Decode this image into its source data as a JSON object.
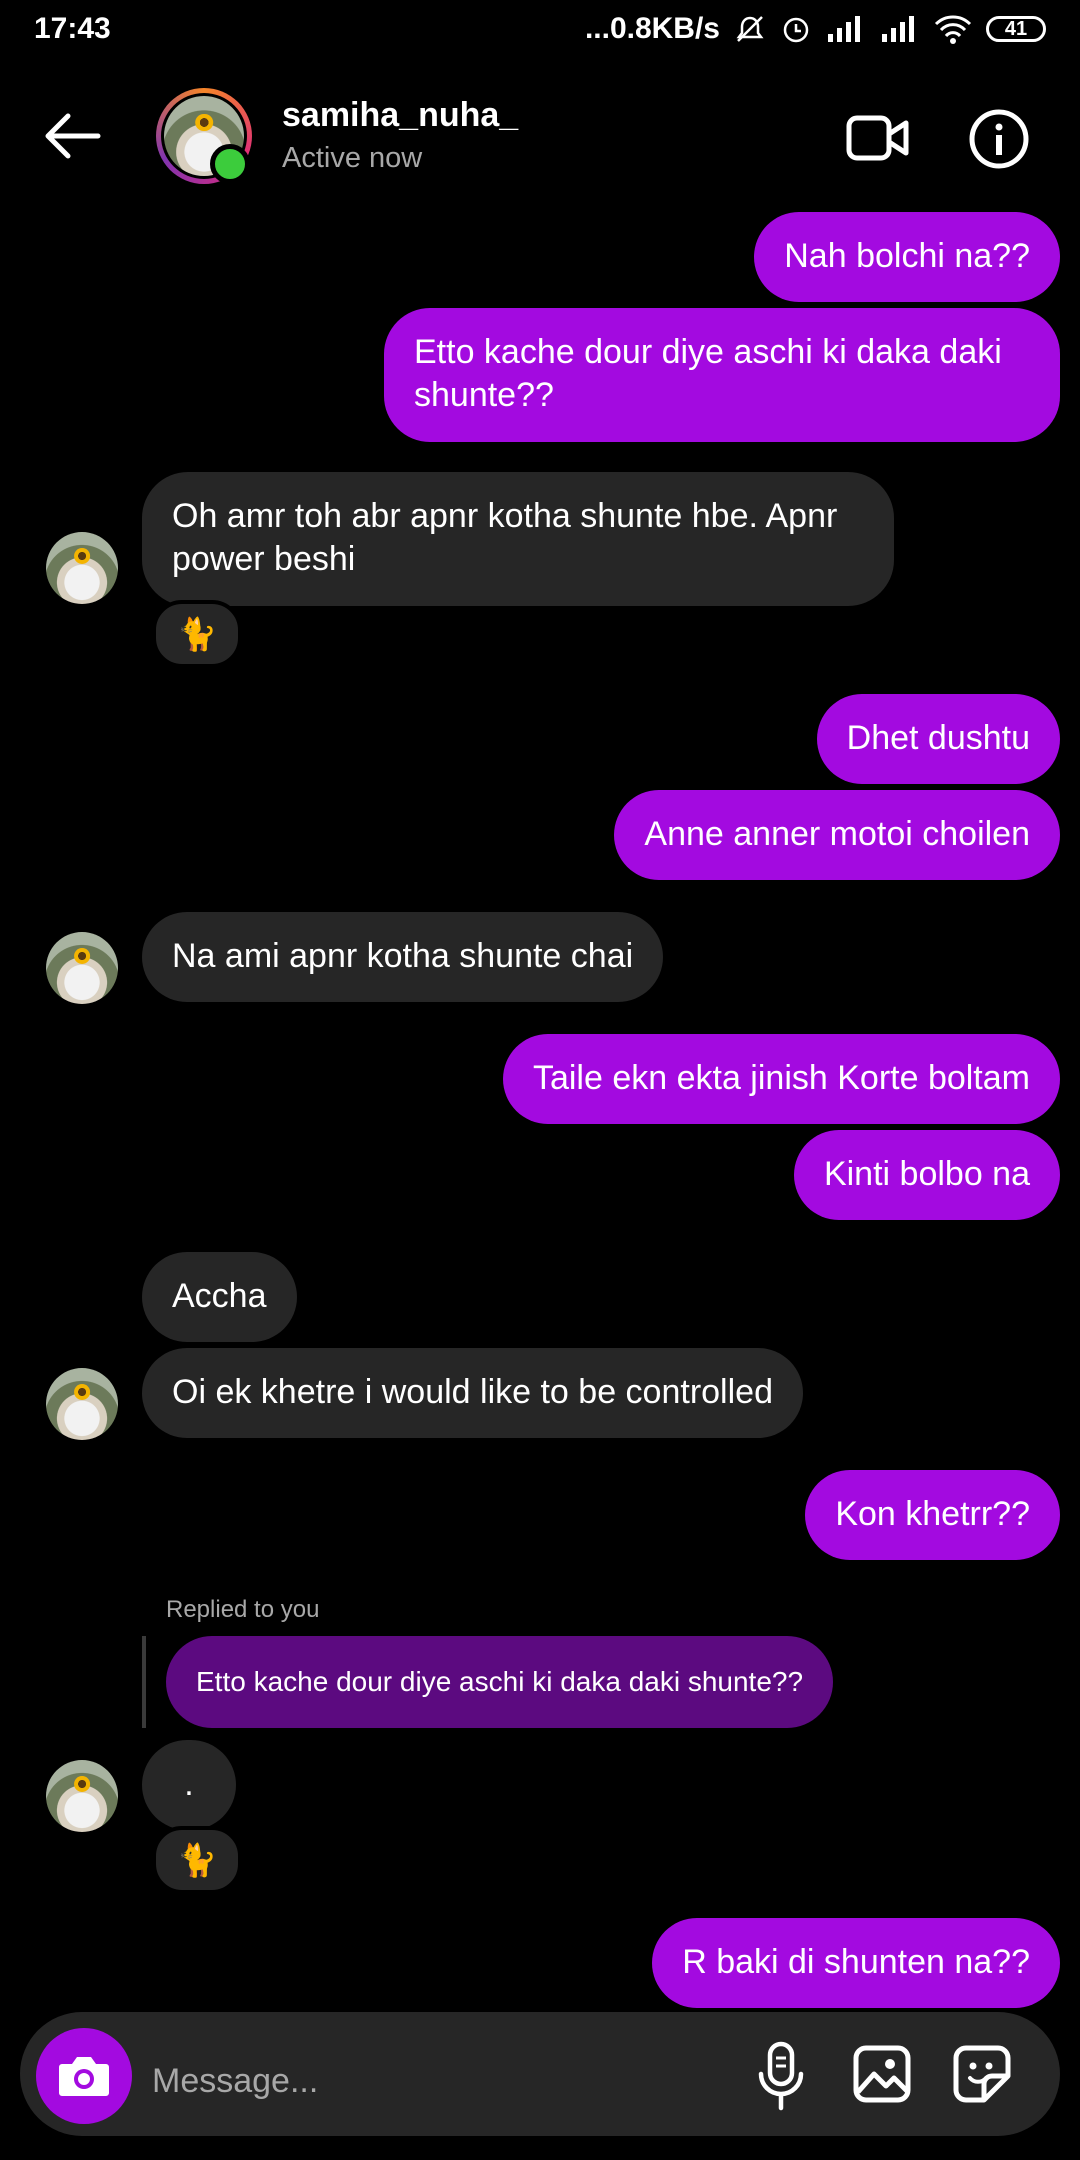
{
  "status_bar": {
    "time": "17:43",
    "net_speed": "...0.8KB/s",
    "battery": "41"
  },
  "header": {
    "username": "samiha_nuha_",
    "status": "Active now"
  },
  "messages": [
    {
      "from": "me",
      "text": "Nah bolchi na??"
    },
    {
      "from": "me",
      "text": "Etto kache dour diye aschi ki daka daki shunte??"
    },
    {
      "from": "them",
      "text": "Oh amr toh abr apnr kotha shunte hbe. Apnr power beshi",
      "reaction": "🐈"
    },
    {
      "from": "me",
      "text": "Dhet dushtu"
    },
    {
      "from": "me",
      "text": "Anne anner motoi choilen"
    },
    {
      "from": "them",
      "text": "Na ami apnr kotha shunte chai"
    },
    {
      "from": "me",
      "text": "Taile ekn ekta jinish Korte boltam"
    },
    {
      "from": "me",
      "text": "Kinti bolbo na"
    },
    {
      "from": "them",
      "text": "Accha"
    },
    {
      "from": "them",
      "text": "Oi ek khetre i would like to be controlled"
    },
    {
      "from": "me",
      "text": "Kon khetrr??"
    },
    {
      "from": "them",
      "reply_label": "Replied to you",
      "quoted": "Etto kache dour diye aschi ki daka daki shunte??",
      "text": ".",
      "reaction": "🐈"
    },
    {
      "from": "me",
      "text": "R baki di shunten na??"
    }
  ],
  "composer": {
    "placeholder": "Message..."
  },
  "colors": {
    "sent_bubble": "#a30ae0",
    "received_bubble": "#262626",
    "quoted_bubble": "#5c0a80",
    "online": "#3ccc3c"
  }
}
